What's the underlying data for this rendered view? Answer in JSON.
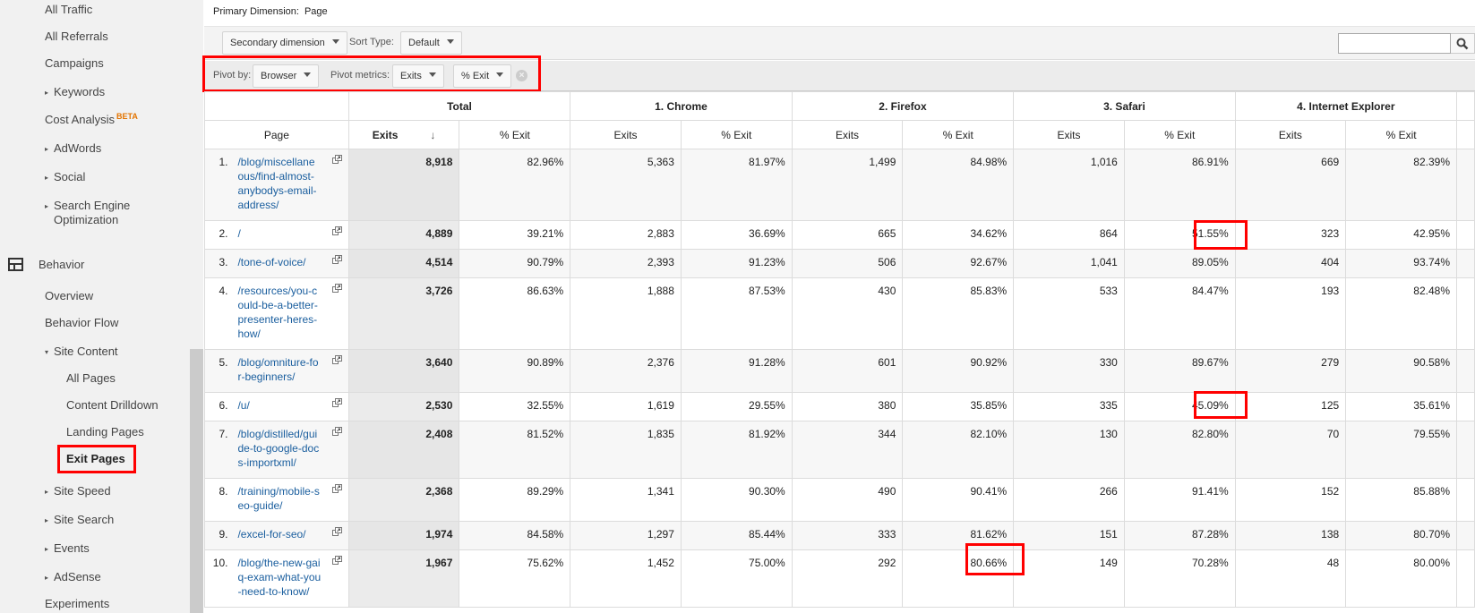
{
  "sidebar": {
    "items": [
      {
        "label": "All Traffic"
      },
      {
        "label": "All Referrals"
      },
      {
        "label": "Campaigns"
      },
      {
        "label": "Keywords",
        "expandable": true
      },
      {
        "label": "Cost Analysis",
        "badge": "BETA"
      },
      {
        "label": "AdWords",
        "expandable": true
      },
      {
        "label": "Social",
        "expandable": true
      },
      {
        "label": "Search Engine",
        "label2": "Optimization",
        "expandable": true
      }
    ],
    "section": {
      "label": "Behavior",
      "icon": "behavior-icon"
    },
    "behavior_items": [
      {
        "label": "Overview"
      },
      {
        "label": "Behavior Flow"
      },
      {
        "label": "Site Content",
        "expanded": true
      },
      {
        "label": "All Pages"
      },
      {
        "label": "Content Drilldown"
      },
      {
        "label": "Landing Pages"
      },
      {
        "label": "Exit Pages",
        "selected": true
      },
      {
        "label": "Site Speed",
        "expandable": true
      },
      {
        "label": "Site Search",
        "expandable": true
      },
      {
        "label": "Events",
        "expandable": true
      },
      {
        "label": "AdSense",
        "expandable": true
      },
      {
        "label": "Experiments"
      }
    ]
  },
  "header": {
    "primary_dimension_label": "Primary Dimension:",
    "primary_dimension_value": "Page",
    "secondary_dimension": "Secondary dimension",
    "sort_type_label": "Sort Type:",
    "sort_type_value": "Default",
    "search_placeholder": ""
  },
  "pivot": {
    "pivot_by_label": "Pivot by:",
    "pivot_by_value": "Browser",
    "pivot_metrics_label": "Pivot metrics:",
    "metric1": "Exits",
    "metric2": "% Exit"
  },
  "table": {
    "page_header": "Page",
    "groups": [
      "Total",
      "1. Chrome",
      "2. Firefox",
      "3. Safari",
      "4. Internet Explorer"
    ],
    "sub_headers": [
      "Exits",
      "% Exit"
    ],
    "rows": [
      {
        "idx": "1.",
        "page": "/blog/miscellaneous/find-almost-anybodys-email-address/",
        "page_lines": [
          "/blog/miscellane",
          "ous/find-almost-",
          "anybodys-email-",
          "address/"
        ],
        "values": [
          "8,918",
          "82.96%",
          "5,363",
          "81.97%",
          "1,499",
          "84.98%",
          "1,016",
          "86.91%",
          "669",
          "82.39%"
        ]
      },
      {
        "idx": "2.",
        "page": "/",
        "page_lines": [
          "/"
        ],
        "values": [
          "4,889",
          "39.21%",
          "2,883",
          "36.69%",
          "665",
          "34.62%",
          "864",
          "51.55%",
          "323",
          "42.95%"
        ]
      },
      {
        "idx": "3.",
        "page": "/tone-of-voice/",
        "page_lines": [
          "/tone-of-voice/"
        ],
        "values": [
          "4,514",
          "90.79%",
          "2,393",
          "91.23%",
          "506",
          "92.67%",
          "1,041",
          "89.05%",
          "404",
          "93.74%"
        ]
      },
      {
        "idx": "4.",
        "page": "/resources/you-could-be-a-better-presenter-heres-how/",
        "page_lines": [
          "/resources/you-c",
          "ould-be-a-better-",
          "presenter-heres-",
          "how/"
        ],
        "values": [
          "3,726",
          "86.63%",
          "1,888",
          "87.53%",
          "430",
          "85.83%",
          "533",
          "84.47%",
          "193",
          "82.48%"
        ]
      },
      {
        "idx": "5.",
        "page": "/blog/omniture-for-beginners/",
        "page_lines": [
          "/blog/omniture-fo",
          "r-beginners/"
        ],
        "values": [
          "3,640",
          "90.89%",
          "2,376",
          "91.28%",
          "601",
          "90.92%",
          "330",
          "89.67%",
          "279",
          "90.58%"
        ]
      },
      {
        "idx": "6.",
        "page": "/u/",
        "page_lines": [
          "/u/"
        ],
        "values": [
          "2,530",
          "32.55%",
          "1,619",
          "29.55%",
          "380",
          "35.85%",
          "335",
          "45.09%",
          "125",
          "35.61%"
        ]
      },
      {
        "idx": "7.",
        "page": "/blog/distilled/guide-to-google-docs-importxml/",
        "page_lines": [
          "/blog/distilled/gui",
          "de-to-google-doc",
          "s-importxml/"
        ],
        "values": [
          "2,408",
          "81.52%",
          "1,835",
          "81.92%",
          "344",
          "82.10%",
          "130",
          "82.80%",
          "70",
          "79.55%"
        ]
      },
      {
        "idx": "8.",
        "page": "/training/mobile-seo-guide/",
        "page_lines": [
          "/training/mobile-s",
          "eo-guide/"
        ],
        "values": [
          "2,368",
          "89.29%",
          "1,341",
          "90.30%",
          "490",
          "90.41%",
          "266",
          "91.41%",
          "152",
          "85.88%"
        ]
      },
      {
        "idx": "9.",
        "page": "/excel-for-seo/",
        "page_lines": [
          "/excel-for-seo/"
        ],
        "values": [
          "1,974",
          "84.58%",
          "1,297",
          "85.44%",
          "333",
          "81.62%",
          "151",
          "87.28%",
          "138",
          "80.70%"
        ]
      },
      {
        "idx": "10.",
        "page": "/blog/the-new-gaiq-exam-what-you-need-to-know/",
        "page_lines": [
          "/blog/the-new-gai",
          "q-exam-what-you",
          "-need-to-know/"
        ],
        "values": [
          "1,967",
          "75.62%",
          "1,452",
          "75.00%",
          "292",
          "80.66%",
          "149",
          "70.28%",
          "48",
          "80.00%"
        ]
      }
    ]
  },
  "highlights": {
    "color": "#ff0000",
    "cells": [
      "row 2 Safari % Exit",
      "row 6 Safari % Exit",
      "row 10 Firefox % Exit"
    ],
    "regions": [
      "pivot controls",
      "Exit Pages nav item"
    ]
  },
  "colors": {
    "link": "#1a5e9e",
    "beta": "#e37400",
    "sidebar_bg": "#f1f1f1",
    "highlight": "#ff0000"
  }
}
